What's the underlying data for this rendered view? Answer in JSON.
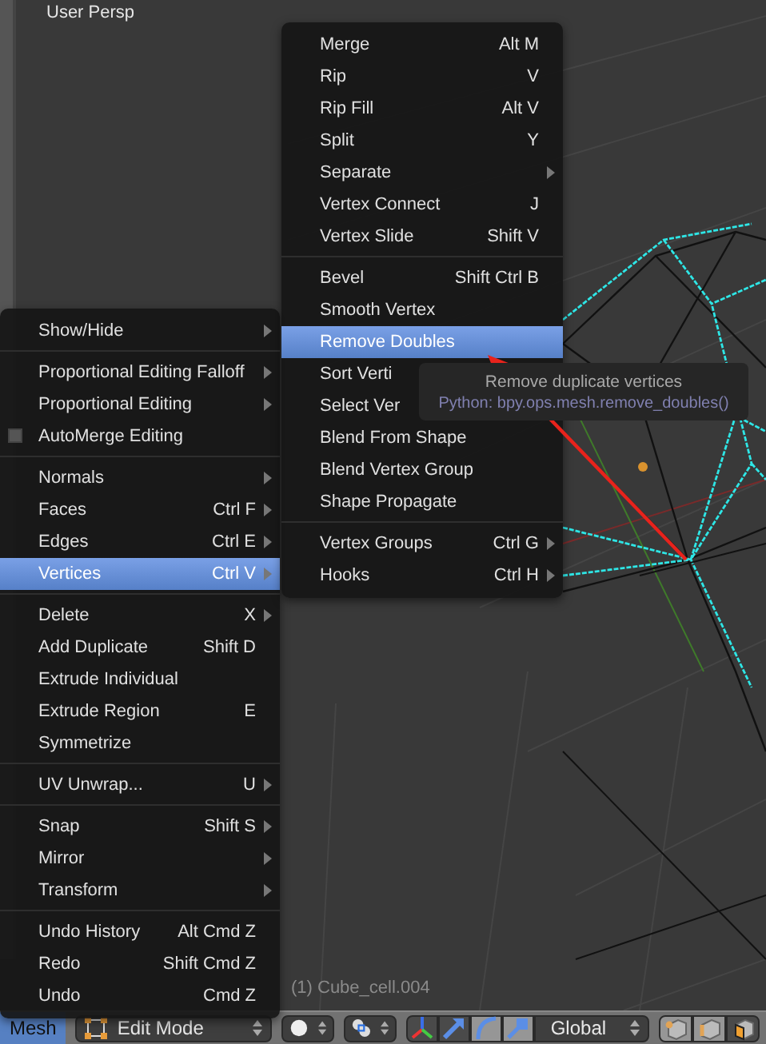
{
  "viewport": {
    "label": "User Persp",
    "object_info": "(1) Cube_cell.004"
  },
  "mesh_menu": {
    "sections": [
      [
        {
          "label": "Show/Hide",
          "submenu": true,
          "kind": "item",
          "selected": false
        }
      ],
      [
        {
          "label": "Proportional Editing Falloff",
          "submenu": true,
          "kind": "item",
          "selected": false
        },
        {
          "label": "Proportional Editing",
          "submenu": true,
          "kind": "item",
          "selected": false
        },
        {
          "label": "AutoMerge Editing",
          "submenu": false,
          "kind": "checkbox",
          "checked": false,
          "selected": false
        }
      ],
      [
        {
          "label": "Normals",
          "submenu": true,
          "kind": "item",
          "selected": false
        },
        {
          "label": "Faces",
          "shortcut": "Ctrl F",
          "submenu": true,
          "kind": "item",
          "selected": false
        },
        {
          "label": "Edges",
          "shortcut": "Ctrl E",
          "submenu": true,
          "kind": "item",
          "selected": false
        },
        {
          "label": "Vertices",
          "shortcut": "Ctrl V",
          "submenu": true,
          "kind": "item",
          "selected": true
        }
      ],
      [
        {
          "label": "Delete",
          "shortcut": "X",
          "submenu": true,
          "kind": "item",
          "selected": false
        },
        {
          "label": "Add Duplicate",
          "shortcut": "Shift D",
          "submenu": false,
          "kind": "item",
          "selected": false
        },
        {
          "label": "Extrude Individual",
          "submenu": false,
          "kind": "item",
          "selected": false
        },
        {
          "label": "Extrude Region",
          "shortcut": "E",
          "submenu": false,
          "kind": "item",
          "selected": false
        },
        {
          "label": "Symmetrize",
          "submenu": false,
          "kind": "item",
          "selected": false
        }
      ],
      [
        {
          "label": "UV Unwrap...",
          "shortcut": "U",
          "submenu": true,
          "kind": "item",
          "selected": false
        }
      ],
      [
        {
          "label": "Snap",
          "shortcut": "Shift S",
          "submenu": true,
          "kind": "item",
          "selected": false
        },
        {
          "label": "Mirror",
          "submenu": true,
          "kind": "item",
          "selected": false
        },
        {
          "label": "Transform",
          "submenu": true,
          "kind": "item",
          "selected": false
        }
      ],
      [
        {
          "label": "Undo History",
          "shortcut": "Alt Cmd Z",
          "submenu": false,
          "kind": "item",
          "selected": false
        },
        {
          "label": "Redo",
          "shortcut": "Shift Cmd Z",
          "submenu": false,
          "kind": "item",
          "selected": false
        },
        {
          "label": "Undo",
          "shortcut": "Cmd Z",
          "submenu": false,
          "kind": "item",
          "selected": false
        }
      ]
    ]
  },
  "vertices_menu": {
    "sections": [
      [
        {
          "label": "Merge",
          "shortcut": "Alt M",
          "submenu": false,
          "selected": false
        },
        {
          "label": "Rip",
          "shortcut": "V",
          "submenu": false,
          "selected": false
        },
        {
          "label": "Rip Fill",
          "shortcut": "Alt V",
          "submenu": false,
          "selected": false
        },
        {
          "label": "Split",
          "shortcut": "Y",
          "submenu": false,
          "selected": false
        },
        {
          "label": "Separate",
          "submenu": true,
          "selected": false
        },
        {
          "label": "Vertex Connect",
          "shortcut": "J",
          "submenu": false,
          "selected": false
        },
        {
          "label": "Vertex Slide",
          "shortcut": "Shift V",
          "submenu": false,
          "selected": false
        }
      ],
      [
        {
          "label": "Bevel",
          "shortcut": "Shift Ctrl B",
          "submenu": false,
          "selected": false
        },
        {
          "label": "Smooth Vertex",
          "submenu": false,
          "selected": false
        },
        {
          "label": "Remove Doubles",
          "submenu": false,
          "selected": true
        },
        {
          "label": "Sort Verti",
          "submenu": false,
          "selected": false
        },
        {
          "label": "Select Ver",
          "submenu": false,
          "selected": false
        },
        {
          "label": "Blend From Shape",
          "submenu": false,
          "selected": false
        },
        {
          "label": "Blend Vertex Group",
          "submenu": false,
          "selected": false
        },
        {
          "label": "Shape Propagate",
          "submenu": false,
          "selected": false
        }
      ],
      [
        {
          "label": "Vertex Groups",
          "shortcut": "Ctrl G",
          "submenu": true,
          "selected": false
        },
        {
          "label": "Hooks",
          "shortcut": "Ctrl H",
          "submenu": true,
          "selected": false
        }
      ]
    ]
  },
  "tooltip": {
    "title": "Remove duplicate vertices",
    "python": "Python: bpy.ops.mesh.remove_doubles()"
  },
  "header": {
    "menu_button": {
      "label": "Mesh",
      "selected": true
    },
    "mode_dropdown": {
      "value": "Edit Mode"
    },
    "manipulator_buttons": [
      {
        "kind": "axes",
        "selected": true
      },
      {
        "kind": "translate",
        "selected": true
      },
      {
        "kind": "rotate",
        "selected": false
      },
      {
        "kind": "scale",
        "selected": false
      }
    ],
    "orientation_dropdown": {
      "value": "Global"
    },
    "select_mode_buttons": [
      {
        "kind": "vertex",
        "selected": false
      },
      {
        "kind": "edge",
        "selected": false
      },
      {
        "kind": "face",
        "selected": true
      }
    ]
  }
}
